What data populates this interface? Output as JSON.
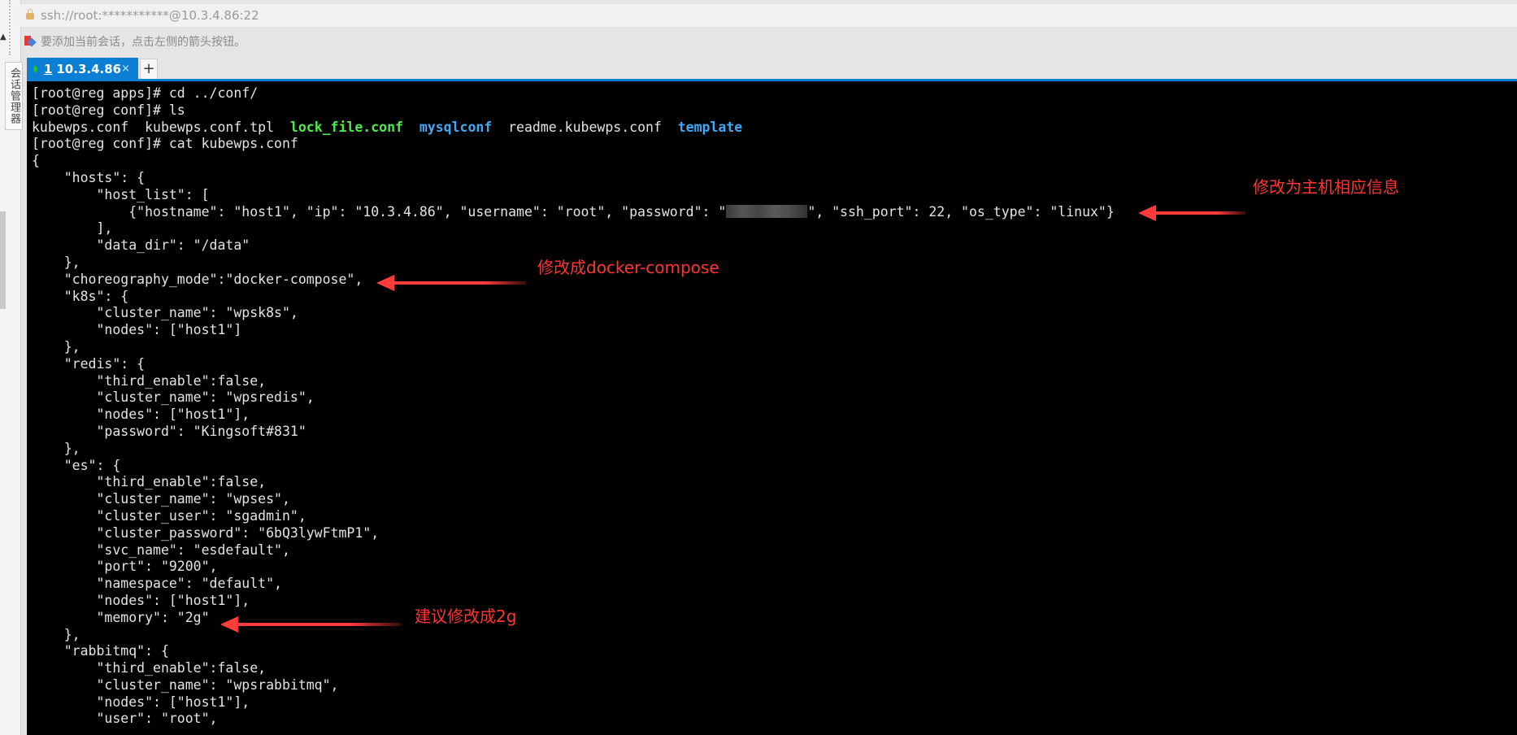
{
  "session_manager_label": "会话管理器",
  "address_bar": "ssh://root:***********@10.3.4.86:22",
  "notice": "要添加当前会话，点击左侧的箭头按钮。",
  "tabs": [
    {
      "number": "1",
      "label": "10.3.4.86",
      "close": "×",
      "status": "connected"
    }
  ],
  "new_tab_label": "+",
  "terminal": {
    "lines": [
      "[root@reg apps]# cd ../conf/",
      "[root@reg conf]# ls",
      "",
      "[root@reg conf]# cat kubewps.conf",
      "{",
      "    \"hosts\": {",
      "        \"host_list\": [",
      "",
      "        ],",
      "        \"data_dir\": \"/data\"",
      "    },",
      "    \"choreography_mode\":\"docker-compose\",",
      "    \"k8s\": {",
      "        \"cluster_name\": \"wpsk8s\",",
      "        \"nodes\": [\"host1\"]",
      "    },",
      "    \"redis\": {",
      "        \"third_enable\":false,",
      "        \"cluster_name\": \"wpsredis\",",
      "        \"nodes\": [\"host1\"],",
      "        \"password\": \"Kingsoft#831\"",
      "    },",
      "    \"es\": {",
      "        \"third_enable\":false,",
      "        \"cluster_name\": \"wpses\",",
      "        \"cluster_user\": \"sgadmin\",",
      "        \"cluster_password\": \"6bQ3lywFtmP1\",",
      "        \"svc_name\": \"esdefault\",",
      "        \"port\": \"9200\",",
      "        \"namespace\": \"default\",",
      "        \"nodes\": [\"host1\"],",
      "        \"memory\": \"2g\"",
      "    },",
      "    \"rabbitmq\": {",
      "        \"third_enable\":false,",
      "        \"cluster_name\": \"wpsrabbitmq\",",
      "        \"nodes\": [\"host1\"],",
      "        \"user\": \"root\","
    ],
    "ls_output": {
      "f1": "kubewps.conf  ",
      "f2": "kubewps.conf.tpl  ",
      "f3": "lock_file.conf",
      "f4": "mysqlconf",
      "f5": "readme.kubewps.conf",
      "f6": "template"
    },
    "host_line_before": "            {\"hostname\": \"host1\", \"ip\": \"10.3.4.86\", \"username\": \"root\", \"password\": \"",
    "host_line_after": "\", \"ssh_port\": 22, \"os_type\": \"linux\"}"
  },
  "annotations": {
    "host_info": "修改为主机相应信息",
    "docker_compose": "修改成docker-compose",
    "memory": "建议修改成2g"
  },
  "colors": {
    "accent": "#0a7fd4",
    "annotation": "#ff3333",
    "exec_file": "#4fe84f",
    "directory": "#3fa9f5"
  }
}
